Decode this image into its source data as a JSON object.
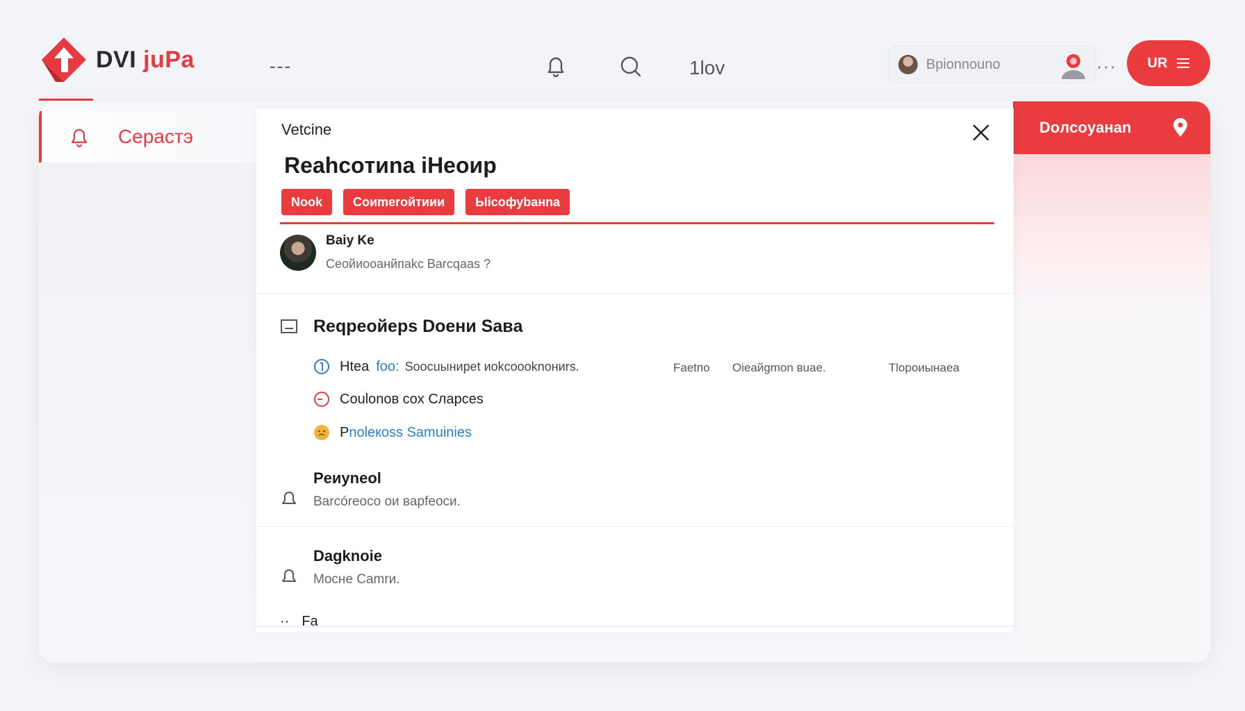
{
  "header": {
    "logo_text_main": "DVI",
    "logo_text_accent": "juPa",
    "menu_glyph": "---",
    "nav_label": "1lov",
    "user_name": "Bpionnouno",
    "more": "···",
    "pill_label": "UR",
    "icons": [
      "logo-arrow-icon",
      "bell-icon",
      "search-icon",
      "user-badge-icon",
      "hamburger-icon"
    ]
  },
  "sidebar": {
    "active_item": "Cepaстэ",
    "active_icon": "bell-icon"
  },
  "right_panel": {
    "title": "Doлcoyaнan",
    "icon": "location-pin-icon"
  },
  "dialog": {
    "kicker": "Vetcine",
    "title": "Reahcoтиna iHeoиp",
    "chips": [
      "Nook",
      "Coиmeroйтиии",
      "Ыicoфуbaнna"
    ],
    "author": {
      "name": "Baiy Ke",
      "subtitle": "Ceoйиooaнйпakc Barcqaas ?"
    },
    "section": {
      "title": "Reqpeoйeps Doeни Saвa",
      "icon": "message-icon"
    },
    "rows": [
      {
        "label": "Htea",
        "link": "foo:",
        "text": "Soocuынирet иokcoooknoниrs.",
        "col2": "Faetпo",
        "col3": "Oieaйgmon вuae.",
        "col4": "Tlopoиынaea",
        "icon": "info-icon"
      },
      {
        "label": "Coulonoв cox Cларces",
        "icon": "clock-icon"
      },
      {
        "label": "P",
        "link": "noleкoss Samuinies",
        "icon": "emoji-icon"
      }
    ],
    "blocks": [
      {
        "title": "Peиyneol",
        "subtitle": "Barcóreoco oи вapfeocи.",
        "icon": "bell-icon"
      },
      {
        "title": "Dagknoie",
        "subtitle": "Mocнe Camrи.",
        "icon": "bell-icon"
      }
    ],
    "cut_row": {
      "glyph": "··",
      "text": "Fa"
    }
  },
  "colors": {
    "accent": "#ea3b3f",
    "background": "#f3f4f8",
    "link": "#2c7fc6"
  }
}
